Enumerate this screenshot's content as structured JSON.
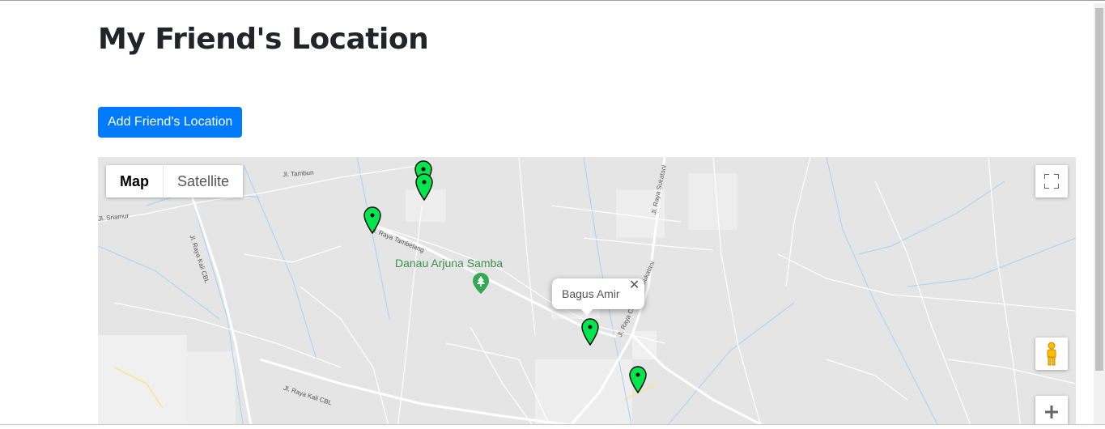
{
  "page": {
    "title": "My Friend's Location",
    "add_button_label": "Add Friend's Location"
  },
  "map": {
    "map_type_options": [
      "Map",
      "Satellite"
    ],
    "selected_map_type": "Map",
    "poi": {
      "name": "Danau Arjuna Samba",
      "icon": "park-tree-icon"
    },
    "road_labels": {
      "tambun": "Jl. Tambun",
      "sriamur": "Jl. Sriamur",
      "raya_tambelang": "Jl. Raya Tambelang",
      "raya_kali_cbl": "Jl. Raya Kali CBL",
      "raya_kali_cbl_2": "Jl. Raya Kali CBL",
      "raya_sukatani": "Jl. Raya Sukatani",
      "raya_cikarang_sukatani": "Jl. Raya Cikarang - Sukatani"
    },
    "info_window": {
      "text": "Bagus Amir",
      "close_icon": "close-icon"
    },
    "markers_count": 5,
    "marker_color": "#00e64d",
    "controls": [
      "fullscreen-icon",
      "pegman-icon",
      "zoom-in-icon"
    ]
  },
  "colors": {
    "primary": "#007bff",
    "map_bg": "#e5e5e5",
    "water": "#a6d1f5",
    "poi_green": "#3d8f4e"
  }
}
